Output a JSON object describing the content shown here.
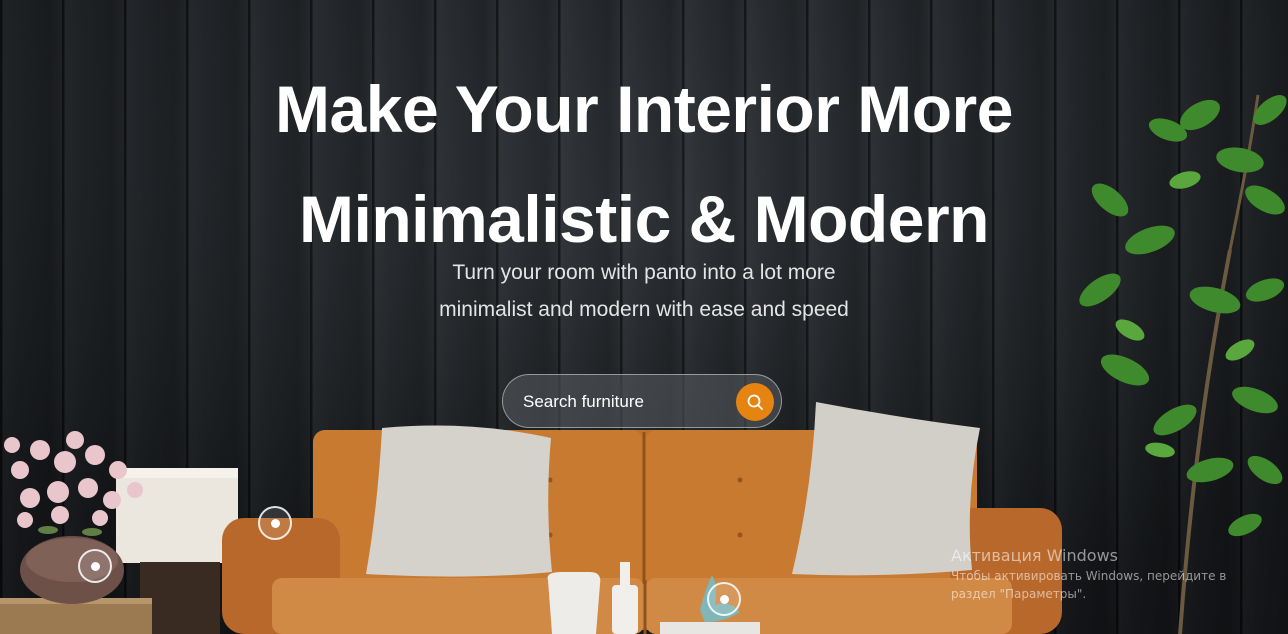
{
  "hero": {
    "headline": [
      "Make Your Interior More",
      "Minimalistic & Modern"
    ],
    "subtitle": [
      "Turn your room with panto into a lot more",
      "minimalist and modern with ease and speed"
    ]
  },
  "search": {
    "placeholder": "Search furniture",
    "button_icon": "search-icon"
  },
  "colors": {
    "accent": "#e58411",
    "text": "#ffffff",
    "wall": "#25292e",
    "sofa": "#c9782f"
  },
  "hotspots": [
    "lamp",
    "flower-pot",
    "vase"
  ],
  "windows_activation": {
    "title": "Активация Windows",
    "text": "Чтобы активировать Windows, перейдите в раздел \"Параметры\"."
  }
}
